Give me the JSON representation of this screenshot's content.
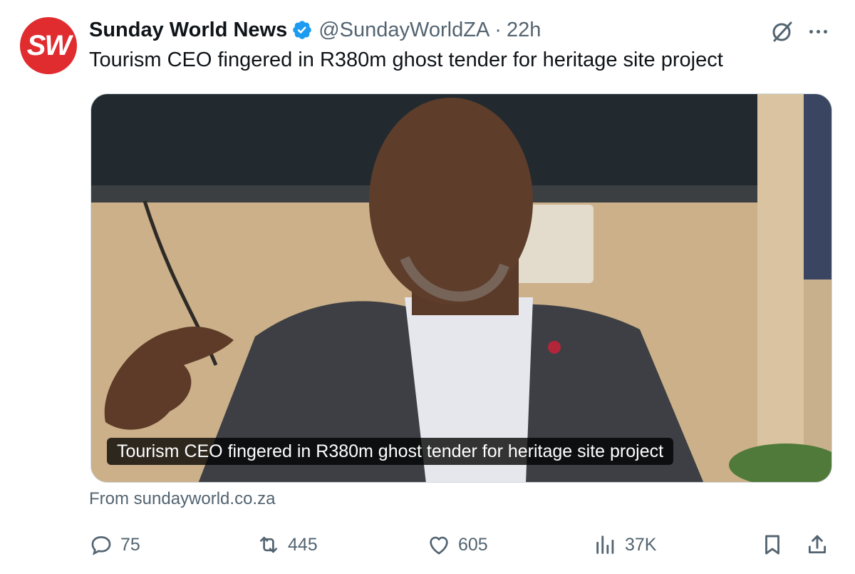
{
  "account": {
    "avatar_text": "SW",
    "display_name": "Sunday World News",
    "handle": "@SundayWorldZA",
    "separator": "·",
    "time": "22h",
    "brand_color": "#e02b2f",
    "verified_color": "#1d9bf0"
  },
  "tweet": {
    "text": "Tourism CEO fingered in R380m ghost tender for heritage site project"
  },
  "card": {
    "caption": "Tourism CEO fingered in R380m ghost tender for heritage site project",
    "source": "From sundayworld.co.za"
  },
  "actions": {
    "replies": "75",
    "reposts": "445",
    "likes": "605",
    "views": "37K"
  },
  "icons": {
    "more": "ellipsis-icon",
    "grok": "grok-icon",
    "reply": "reply-icon",
    "repost": "repost-icon",
    "like": "heart-icon",
    "views": "views-icon",
    "bookmark": "bookmark-icon",
    "share": "share-icon"
  }
}
